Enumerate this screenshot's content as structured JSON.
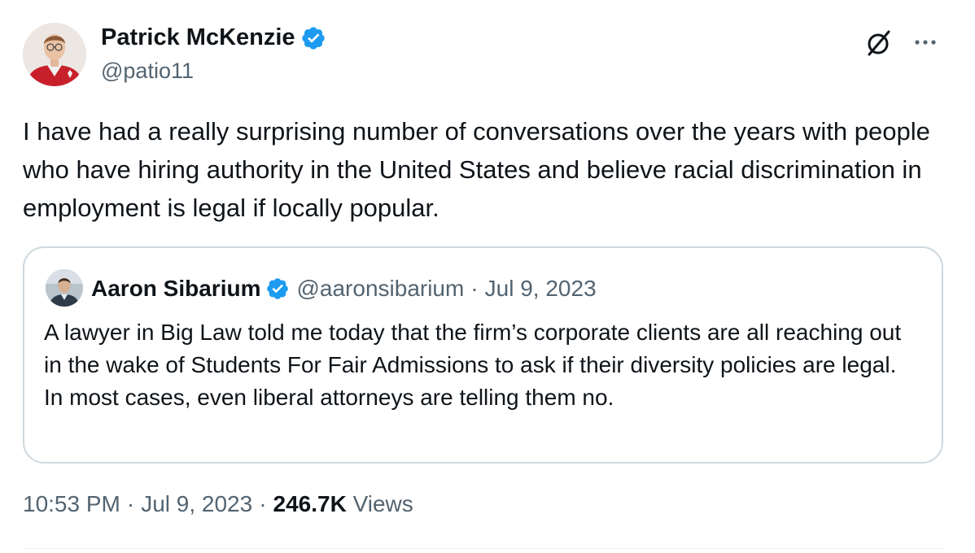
{
  "author": {
    "name": "Patrick McKenzie",
    "handle": "@patio11",
    "verified_icon": "verified-badge-icon"
  },
  "tweet": {
    "text": "I have had a really surprising number of conversations over the years with people who have hiring authority in the United States and believe racial discrimination in employment is legal if locally popular."
  },
  "quoted_tweet": {
    "author_name": "Aaron Sibarium",
    "handle": "@aaronsibarium",
    "separator": "·",
    "date": "Jul 9, 2023",
    "text": "A lawyer in Big Law told me today that the firm’s corporate clients are all reaching out in the wake of Students For Fair Admissions to ask if their diversity policies are legal. In most cases, even liberal attorneys are telling them no."
  },
  "meta": {
    "time": "10:53 PM",
    "separator": "·",
    "date": "Jul 9, 2023",
    "views_count": "246.7K",
    "views_label": "Views"
  },
  "icons": {
    "grok": "grok-icon",
    "more": "more-icon"
  },
  "colors": {
    "text_primary": "#0f1419",
    "text_secondary": "#536471",
    "verified_blue": "#1d9bf0",
    "border": "#cfd9de"
  }
}
